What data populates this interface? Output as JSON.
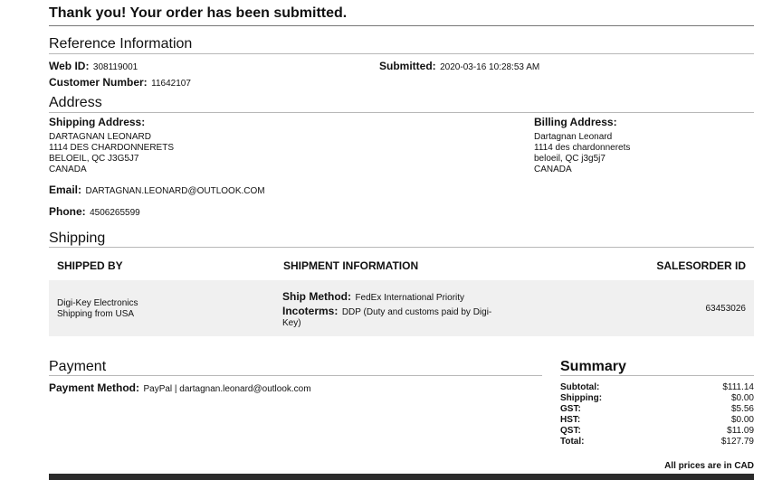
{
  "header": {
    "title": "Thank you! Your order has been submitted."
  },
  "reference": {
    "heading": "Reference Information",
    "web_id_label": "Web ID:",
    "web_id": "308119001",
    "customer_label": "Customer Number:",
    "customer_number": "11642107",
    "submitted_label": "Submitted:",
    "submitted": "2020-03-16 10:28:53 AM"
  },
  "address": {
    "heading": "Address",
    "shipping_label": "Shipping Address:",
    "shipping_lines": [
      "DARTAGNAN LEONARD",
      "1114 DES CHARDONNERETS",
      "BELOEIL, QC J3G5J7",
      "CANADA"
    ],
    "billing_label": "Billing Address:",
    "billing_lines": [
      "Dartagnan Leonard",
      "1114 des chardonnerets",
      "beloeil, QC j3g5j7",
      "CANADA"
    ],
    "email_label": "Email:",
    "email": "DARTAGNAN.LEONARD@OUTLOOK.COM",
    "phone_label": "Phone:",
    "phone": "4506265599"
  },
  "shipping": {
    "heading": "Shipping",
    "columns": [
      "SHIPPED BY",
      "SHIPMENT INFORMATION",
      "SALESORDER ID"
    ],
    "shipped_by_lines": [
      "Digi-Key Electronics",
      "Shipping from USA"
    ],
    "ship_method_label": "Ship Method:",
    "ship_method": "FedEx International Priority",
    "incoterms_label": "Incoterms:",
    "incoterms_line1": "DDP (Duty and customs paid by Digi-",
    "incoterms_line2": "Key)",
    "salesorder_id": "63453026"
  },
  "payment": {
    "heading": "Payment",
    "method_label": "Payment Method:",
    "method": "PayPal | dartagnan.leonard@outlook.com"
  },
  "summary": {
    "heading": "Summary",
    "rows": [
      {
        "label": "Subtotal:",
        "value": "$111.14"
      },
      {
        "label": "Shipping:",
        "value": "$0.00"
      },
      {
        "label": "GST:",
        "value": "$5.56"
      },
      {
        "label": "HST:",
        "value": "$0.00"
      },
      {
        "label": "QST:",
        "value": "$11.09"
      },
      {
        "label": "Total:",
        "value": "$127.79"
      }
    ],
    "currency_note": "All prices are in CAD"
  }
}
